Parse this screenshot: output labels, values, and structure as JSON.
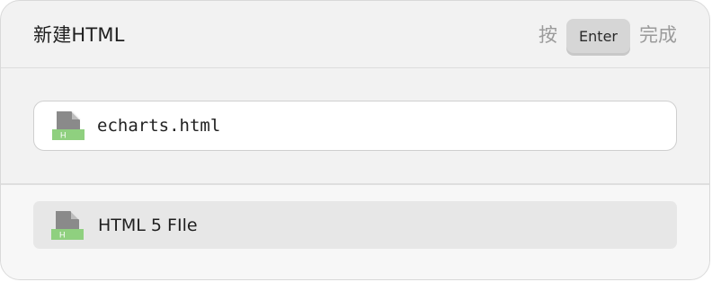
{
  "dialog": {
    "title": "新建HTML",
    "hint": {
      "prefix": "按",
      "key": "Enter",
      "suffix": "完成"
    }
  },
  "input": {
    "value": "echarts.html",
    "icon": "html-file-icon"
  },
  "list": {
    "items": [
      {
        "label": "HTML 5 FIle",
        "icon": "html-file-icon"
      }
    ]
  },
  "colors": {
    "icon_body": "#8a8a8a",
    "icon_badge": "#8fd07f"
  }
}
